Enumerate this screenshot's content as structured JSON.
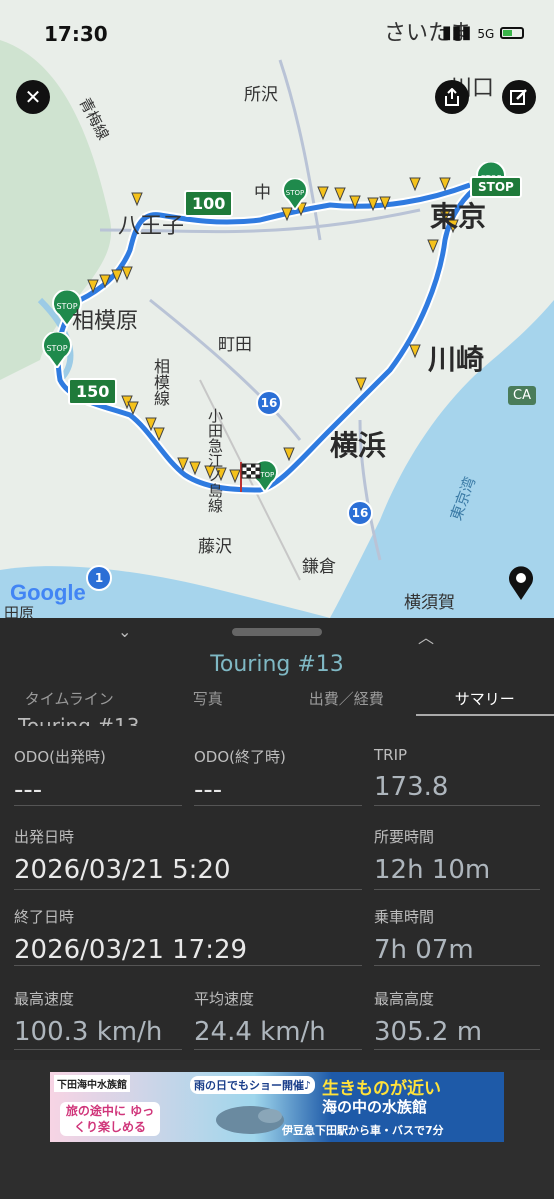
{
  "status": {
    "time": "17:30",
    "network": "5G"
  },
  "map": {
    "places": {
      "saitama": "さいたま",
      "tokorozawa": "所沢",
      "kawaguchi": "川口",
      "omeline": "青梅線",
      "hachioji": "八王子",
      "nakano": "中",
      "tokyo": "東京",
      "sagamihara": "相模原",
      "machida": "町田",
      "kawasaki": "川崎",
      "sagamiline": "相模線",
      "odakyu": "小田急江ノ島線",
      "yokohama": "横浜",
      "fujisawa": "藤沢",
      "kamakura": "鎌倉",
      "yokosuka": "横須賀",
      "tokyobay": "東京湾",
      "odawara": "田原"
    },
    "shields": {
      "a": "100",
      "b": "150"
    },
    "routes": {
      "r16a": "16",
      "r16b": "16",
      "r1": "1"
    },
    "ca": "CA",
    "stop": "STOP",
    "google": "Google"
  },
  "panel": {
    "title": "Touring #13",
    "ghost": "Touring #13",
    "tabs": [
      "タイムライン",
      "写真",
      "出費／経費",
      "サマリー"
    ],
    "stats": {
      "odo_start": {
        "label": "ODO(出発時)",
        "value": "---"
      },
      "odo_end": {
        "label": "ODO(終了時)",
        "value": "---"
      },
      "trip": {
        "label": "TRIP",
        "value": "173.8"
      },
      "start": {
        "label": "出発日時",
        "value": "2026/03/21 5:20"
      },
      "duration": {
        "label": "所要時間",
        "value": "12h 10m"
      },
      "end": {
        "label": "終了日時",
        "value": "2026/03/21 17:29"
      },
      "riding": {
        "label": "乗車時間",
        "value": "7h 07m"
      },
      "maxspeed": {
        "label": "最高速度",
        "value": "100.3 km/h"
      },
      "avgspeed": {
        "label": "平均速度",
        "value": "24.4 km/h"
      },
      "maxalt": {
        "label": "最高高度",
        "value": "305.2 m"
      }
    }
  },
  "ad": {
    "logo": "下田海中水族館",
    "rain": "雨の日でもショー開催♪",
    "pink": "旅の途中に ゆっくり楽しめる",
    "yellow": "生きものが近い",
    "white": "海の中の水族館",
    "bottom": "伊豆急下田駅から車・バスで7分"
  }
}
